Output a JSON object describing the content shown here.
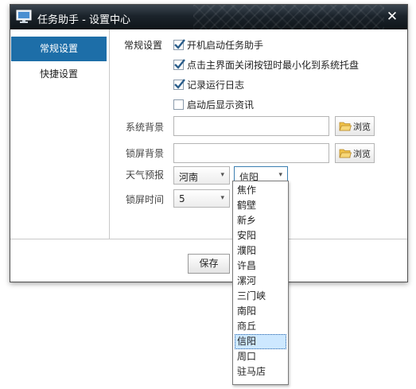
{
  "window": {
    "title": "任务助手 - 设置中心"
  },
  "sidebar": {
    "items": [
      {
        "label": "常规设置"
      },
      {
        "label": "快捷设置"
      }
    ]
  },
  "general": {
    "section_label": "常规设置",
    "checkboxes": [
      {
        "label": "开机启动任务助手",
        "checked": true
      },
      {
        "label": "点击主界面关闭按钮时最小化到系统托盘",
        "checked": true
      },
      {
        "label": "记录运行日志",
        "checked": true
      },
      {
        "label": "启动后显示资讯",
        "checked": false
      }
    ]
  },
  "system_background": {
    "label": "系统背景",
    "value": "",
    "browse_label": "浏览"
  },
  "lock_background": {
    "label": "锁屏背景",
    "value": "",
    "browse_label": "浏览"
  },
  "weather": {
    "label": "天气预报",
    "province": "河南",
    "city": "信阳"
  },
  "lock_time": {
    "label": "锁屏时间",
    "value": "5"
  },
  "city_dropdown": {
    "options": [
      "焦作",
      "鹤壁",
      "新乡",
      "安阳",
      "濮阳",
      "许昌",
      "漯河",
      "三门峡",
      "南阳",
      "商丘",
      "信阳",
      "周口",
      "驻马店"
    ],
    "selected": "信阳"
  },
  "footer": {
    "save_label": "保存"
  },
  "colors": {
    "titlebar": "#1b232b",
    "sidebar_active": "#1d6ea8",
    "checkbox_check": "#2a5d8a"
  }
}
